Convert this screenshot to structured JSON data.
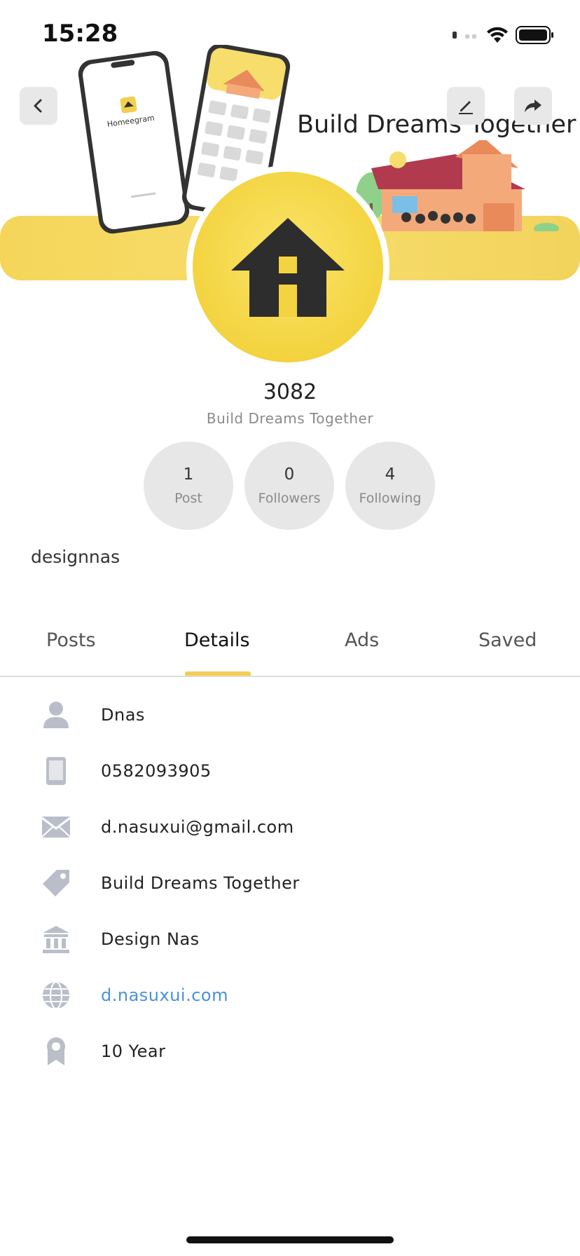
{
  "status_bar": {
    "time": "15:28"
  },
  "banner": {
    "tagline": "Build Dreams Together",
    "phone_app_name": "Homeegram"
  },
  "header": {
    "back_icon": "chevron-left-icon",
    "edit_icon": "pencil-icon",
    "share_icon": "share-arrow-icon"
  },
  "profile": {
    "name": "3082",
    "subtitle": "Build Dreams Together",
    "username": "designnas"
  },
  "stats": [
    {
      "value": "1",
      "label": "Post"
    },
    {
      "value": "0",
      "label": "Followers"
    },
    {
      "value": "4",
      "label": "Following"
    }
  ],
  "tabs": [
    {
      "label": "Posts"
    },
    {
      "label": "Details"
    },
    {
      "label": "Ads"
    },
    {
      "label": "Saved"
    }
  ],
  "active_tab": "Details",
  "details": [
    {
      "icon": "person-icon",
      "value": "Dnas"
    },
    {
      "icon": "phone-icon",
      "value": "0582093905"
    },
    {
      "icon": "email-icon",
      "value": "d.nasuxui@gmail.com"
    },
    {
      "icon": "tag-icon",
      "value": "Build Dreams Together"
    },
    {
      "icon": "bank-icon",
      "value": "Design Nas"
    },
    {
      "icon": "globe-icon",
      "value": "d.nasuxui.com"
    },
    {
      "icon": "award-icon",
      "value": "10 Year"
    }
  ],
  "colors": {
    "accent_yellow": "#f3cf50",
    "link_blue": "#4a90d9",
    "icon_gray": "#b9bec8"
  }
}
